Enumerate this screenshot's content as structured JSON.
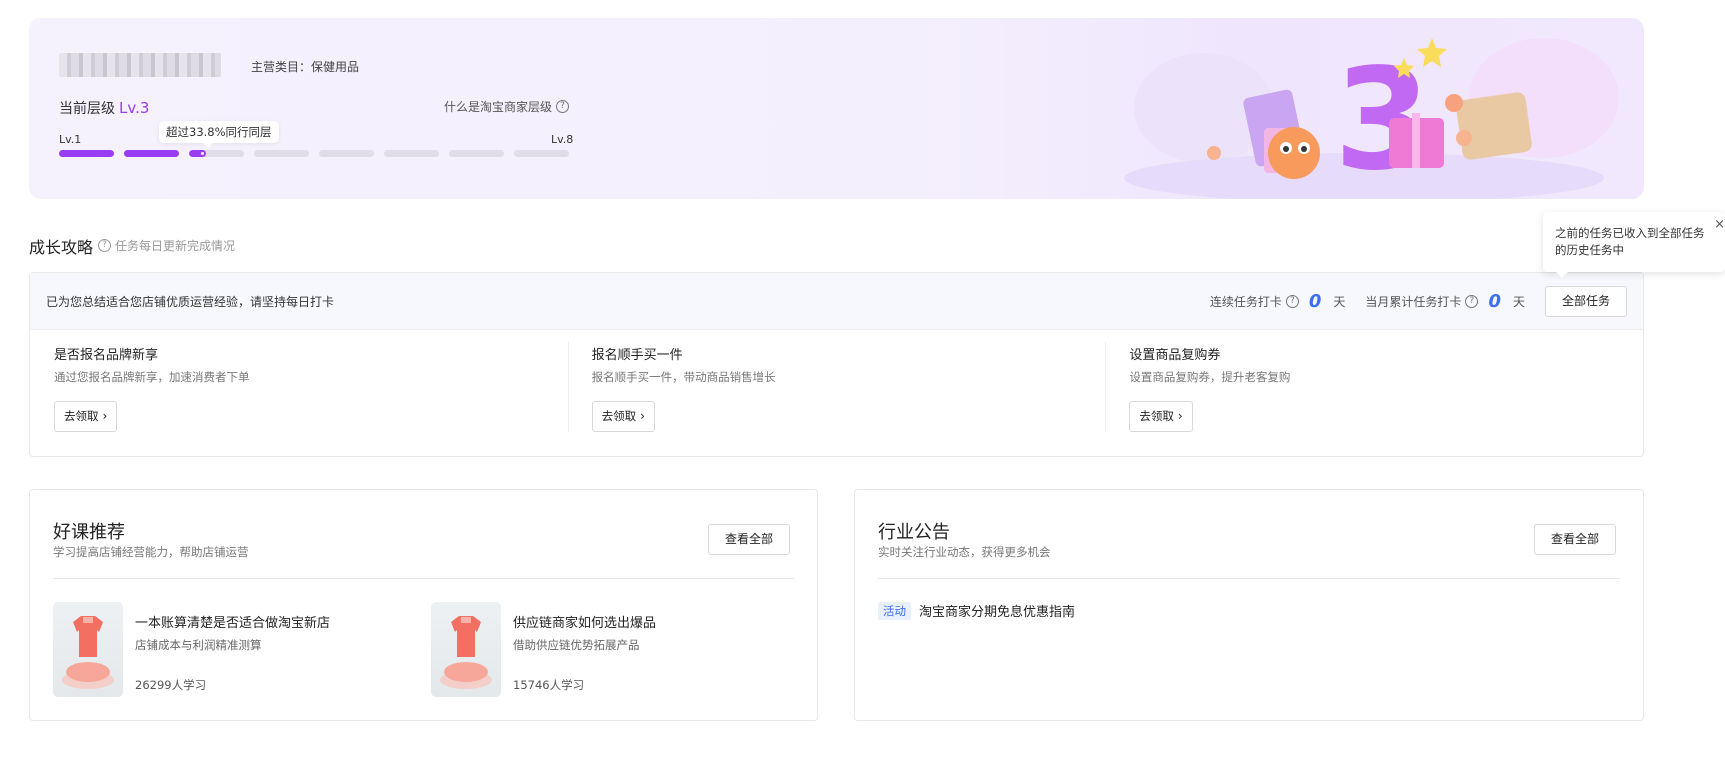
{
  "banner": {
    "category": "主营类目：保健用品",
    "level_prefix": "当前层级",
    "level_value": "Lv.3",
    "what_level": "什么是淘宝商家层级",
    "lv_start": "Lv.1",
    "lv_end": "Lv.8",
    "tooltip": "超过33.8%同行同层",
    "progress": {
      "segments_total": 8,
      "segments_filled": 2,
      "current_fraction": 0.3
    },
    "illustration_digit": "3"
  },
  "growth": {
    "title": "成长攻略",
    "hint": "任务每日更新完成情况",
    "message": "已为您总结适合您店铺优质运营经验，请坚持每日打卡",
    "streak_label": "连续任务打卡",
    "streak_value": "0",
    "monthly_label": "当月累计任务打卡",
    "monthly_value": "0",
    "unit": "天",
    "all_tasks_button": "全部任务",
    "popover": "之前的任务已收入到全部任务的历史任务中",
    "tasks": [
      {
        "title": "是否报名品牌新享",
        "desc": "通过您报名品牌新享，加速消费者下单",
        "button": "去领取"
      },
      {
        "title": "报名顺手买一件",
        "desc": "报名顺手买一件，带动商品销售增长",
        "button": "去领取"
      },
      {
        "title": "设置商品复购券",
        "desc": "设置商品复购券，提升老客复购",
        "button": "去领取"
      }
    ]
  },
  "courses": {
    "title": "好课推荐",
    "subtitle": "学习提高店铺经营能力，帮助店铺运营",
    "view_all": "查看全部",
    "items": [
      {
        "title": "一本账算清楚是否适合做淘宝新店",
        "desc": "店铺成本与利润精准测算",
        "count": "26299人学习"
      },
      {
        "title": "供应链商家如何选出爆品",
        "desc": "借助供应链优势拓展产品",
        "count": "15746人学习"
      }
    ]
  },
  "notices": {
    "title": "行业公告",
    "subtitle": "实时关注行业动态，获得更多机会",
    "view_all": "查看全部",
    "items": [
      {
        "tag": "活动",
        "text": "淘宝商家分期免息优惠指南"
      }
    ]
  },
  "colors": {
    "accent_purple": "#9a3cf2",
    "accent_blue": "#3b6ef7"
  }
}
